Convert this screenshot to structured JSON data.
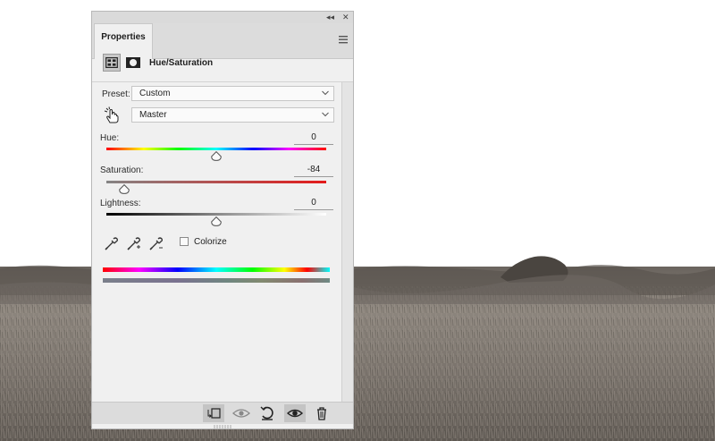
{
  "panel": {
    "tab_label": "Properties",
    "adjustment_title": "Hue/Saturation",
    "preset": {
      "label": "Preset:",
      "value": "Custom"
    },
    "channel": {
      "value": "Master"
    },
    "hue": {
      "label": "Hue:",
      "value": "0",
      "fraction": 0.5
    },
    "saturation": {
      "label": "Saturation:",
      "value": "-84",
      "fraction": 0.08
    },
    "lightness": {
      "label": "Lightness:",
      "value": "0",
      "fraction": 0.5
    },
    "colorize": {
      "label": "Colorize",
      "checked": false
    },
    "icons": {
      "collapse": "collapse-icon",
      "close": "close-icon",
      "menu": "panel-menu-icon",
      "on_image": "on-image-adjustment-hand-icon",
      "eyedroppers": [
        "eyedropper-icon",
        "eyedropper-add-icon",
        "eyedropper-subtract-icon"
      ],
      "footer": [
        "clip-to-layer-icon",
        "view-previous-state-icon",
        "reset-icon",
        "visibility-eye-icon",
        "delete-icon"
      ]
    }
  },
  "colors": {
    "panel_bg": "#f0f0f0",
    "saturation_track_end": "#e31a1a"
  }
}
